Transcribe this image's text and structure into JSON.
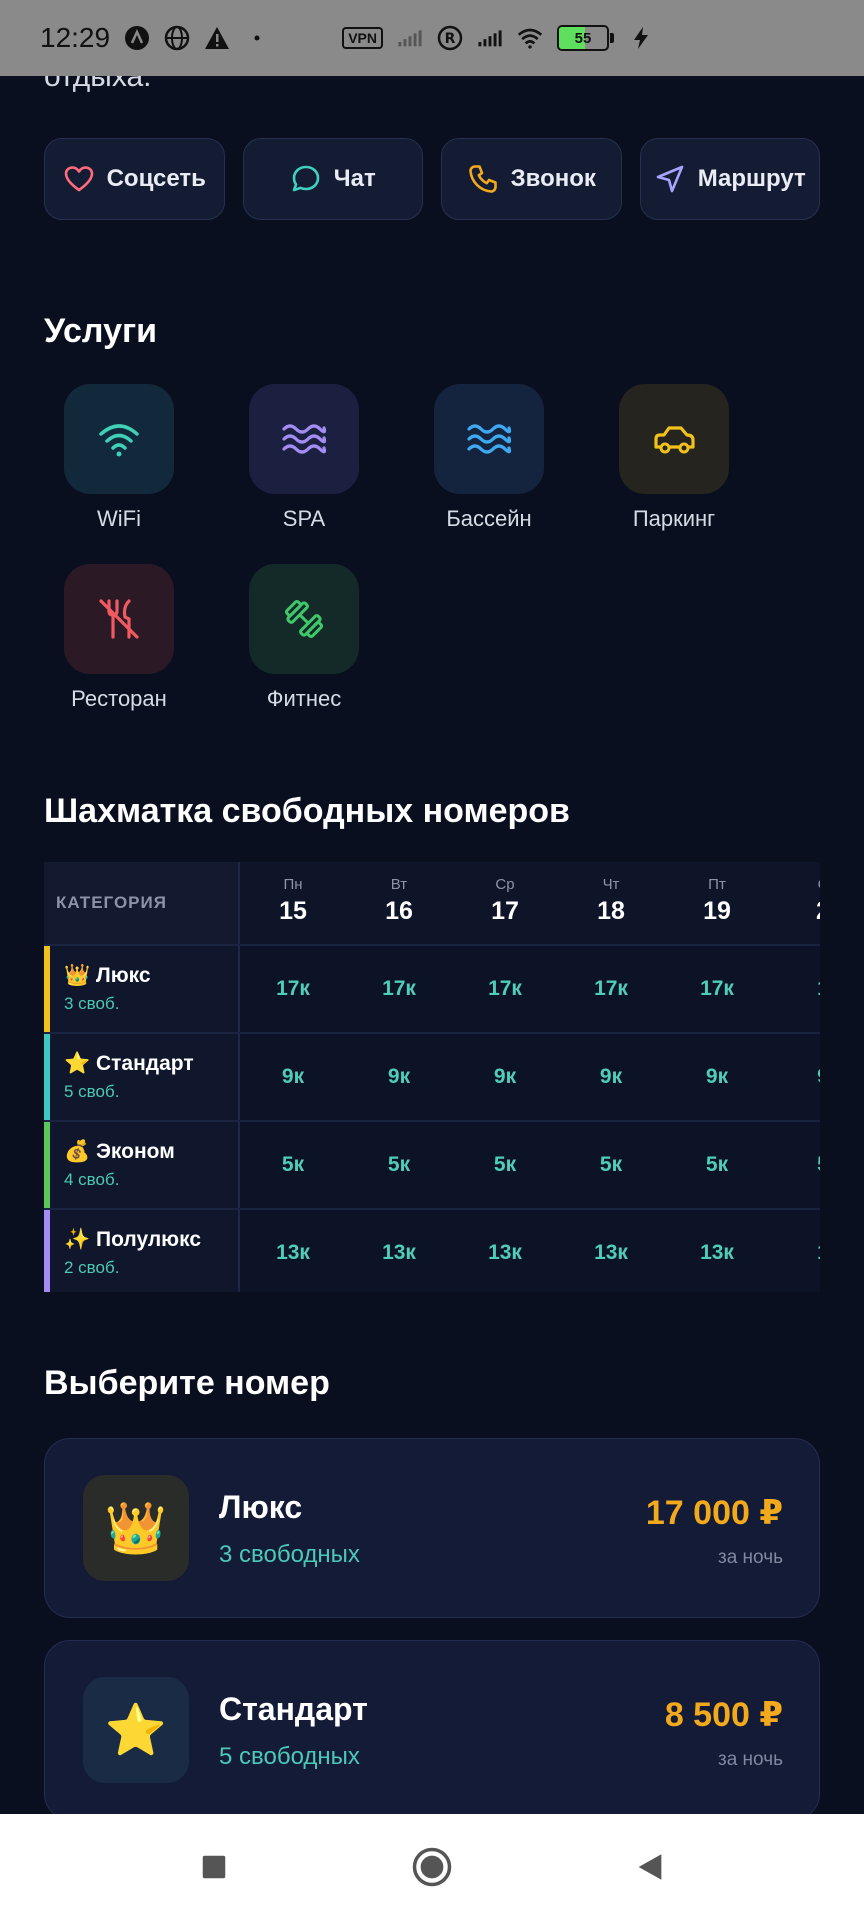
{
  "status": {
    "time": "12:29",
    "vpn": "VPN",
    "battery": "55",
    "battery_level": 0.55
  },
  "intro_fragment": "отдыха.",
  "actions": [
    {
      "label": "Соцсеть",
      "icon": "heart-icon",
      "color": "#ff6b7d"
    },
    {
      "label": "Чат",
      "icon": "chat-bubble-icon",
      "color": "#3fd0c0"
    },
    {
      "label": "Звонок",
      "icon": "phone-icon",
      "color": "#f2a91c"
    },
    {
      "label": "Маршрут",
      "icon": "navigation-arrow-icon",
      "color": "#a9a3ff"
    }
  ],
  "services_title": "Услуги",
  "services": [
    {
      "label": "WiFi",
      "icon": "wifi-icon",
      "color": "#3fd0b6",
      "bg": "#11293a"
    },
    {
      "label": "SPA",
      "icon": "waves-icon",
      "color": "#a38cf2",
      "bg": "#1c2040"
    },
    {
      "label": "Бассейн",
      "icon": "pool-waves-icon",
      "color": "#3ea8f0",
      "bg": "#14243f"
    },
    {
      "label": "Паркинг",
      "icon": "car-icon",
      "color": "#f2c21c",
      "bg": "#26241f"
    },
    {
      "label": "Ресторан",
      "icon": "utensils-off-icon",
      "color": "#f25a62",
      "bg": "#2b1a26"
    },
    {
      "label": "Фитнес",
      "icon": "dumbbell-icon",
      "color": "#3ec86a",
      "bg": "#132a28"
    }
  ],
  "grid_title": "Шахматка свободных номеров",
  "grid": {
    "category_header": "КАТЕГОРИЯ",
    "days": [
      {
        "dow": "Пн",
        "date": "15"
      },
      {
        "dow": "Вт",
        "date": "16"
      },
      {
        "dow": "Ср",
        "date": "17"
      },
      {
        "dow": "Чт",
        "date": "18"
      },
      {
        "dow": "Пт",
        "date": "19"
      },
      {
        "dow": "С",
        "date": "2"
      }
    ],
    "rows": [
      {
        "name": "👑 Люкс",
        "free": "3 своб.",
        "bar": "#f2c21c",
        "cells": [
          "17к",
          "17к",
          "17к",
          "17к",
          "17к",
          "1"
        ]
      },
      {
        "name": "⭐ Стандарт",
        "free": "5 своб.",
        "bar": "#3fc8c0",
        "cells": [
          "9к",
          "9к",
          "9к",
          "9к",
          "9к",
          "9"
        ]
      },
      {
        "name": "💰 Эконом",
        "free": "4 своб.",
        "bar": "#5ac85a",
        "cells": [
          "5к",
          "5к",
          "5к",
          "5к",
          "5к",
          "5"
        ]
      },
      {
        "name": "✨ Полулюкс",
        "free": "2 своб.",
        "bar": "#a38cf2",
        "cells": [
          "13к",
          "13к",
          "13к",
          "13к",
          "13к",
          "1"
        ]
      }
    ]
  },
  "rooms_title": "Выберите номер",
  "rooms": [
    {
      "emoji": "👑",
      "name": "Люкс",
      "free": "3 свободных",
      "price": "17 000 ₽",
      "unit": "за ночь",
      "icon": "crown-icon",
      "bg": "#2a2c2a"
    },
    {
      "emoji": "⭐",
      "name": "Стандарт",
      "free": "5 свободных",
      "price": "8 500 ₽",
      "unit": "за ночь",
      "icon": "star-icon",
      "bg": "#1a2c45"
    }
  ],
  "nav": [
    "recents-square-icon",
    "home-circle-icon",
    "back-triangle-icon"
  ]
}
